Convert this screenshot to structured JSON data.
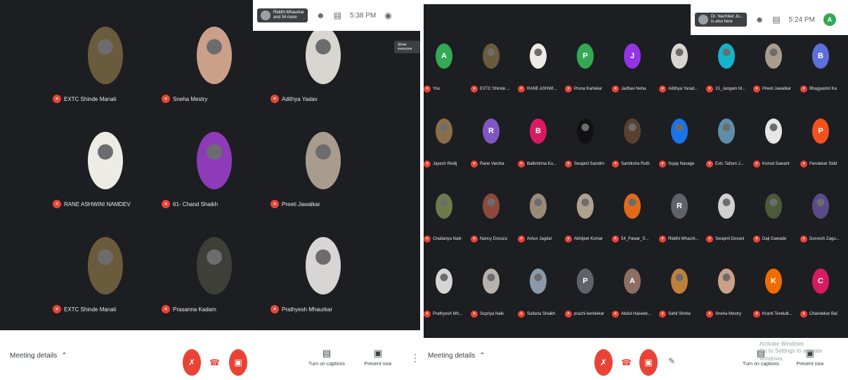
{
  "left": {
    "chip": {
      "name": "Riddhi Mhaurkar",
      "sub": "and 34 more"
    },
    "time": "5:38 PM",
    "tooltip": "Show everyone",
    "tiles": [
      {
        "name": "EXTC Shinde Manali",
        "color": "#6b5b3d"
      },
      {
        "name": "Sneha Mestry",
        "color": "#caa089"
      },
      {
        "name": "Adithya Yadav",
        "color": "#d9d6d2"
      },
      {
        "name": "RANE ASHWINI NAMDEV",
        "color": "#ecebe4"
      },
      {
        "name": "61- Chand Shaikh",
        "color": "#8d3bb8"
      },
      {
        "name": "Preeti Jawalkar",
        "color": "#a89c8e"
      },
      {
        "name": "EXTC Shinde Manali",
        "color": "#6b5b3d"
      },
      {
        "name": "Prasanna Kadam",
        "color": "#3f3f3a"
      },
      {
        "name": "Prathyesh Mhaurkar",
        "color": "#d8d6d4"
      }
    ],
    "meeting_details": "Meeting details",
    "captions": "Turn on captions",
    "present": "Present now"
  },
  "right": {
    "chip": {
      "name": "Dr. Nachiket Jo...",
      "sub": "is also here"
    },
    "time": "5:24 PM",
    "profile_initial": "A",
    "tiles": [
      {
        "name": "You",
        "initial": "A",
        "color": "#34a853"
      },
      {
        "name": "EXTC Shinde ...",
        "initial": "",
        "color": "#6b5b3d"
      },
      {
        "name": "RANE ASHWI...",
        "initial": "",
        "color": "#ecebe4"
      },
      {
        "name": "Pruna Karlekar",
        "initial": "P",
        "color": "#34a853"
      },
      {
        "name": "Jadhav Neha",
        "initial": "J",
        "color": "#9334e6"
      },
      {
        "name": "Adithya Yarad...",
        "initial": "",
        "color": "#d9d6d2"
      },
      {
        "name": "15_Jangam M...",
        "initial": "",
        "color": "#12b5cb"
      },
      {
        "name": "Preeti Jawalkar",
        "initial": "",
        "color": "#a89c8e"
      },
      {
        "name": "Bhagyashri Ka",
        "initial": "B",
        "color": "#5e6fdb"
      },
      {
        "name": "Jayesh Redij",
        "initial": "",
        "color": "#8a6e4a"
      },
      {
        "name": "Rane Varsha",
        "initial": "R",
        "color": "#7e57c2"
      },
      {
        "name": "Balkrishna Ku...",
        "initial": "B",
        "color": "#d81b60"
      },
      {
        "name": "Swapnil Sandim",
        "initial": "",
        "color": "#111111"
      },
      {
        "name": "Samiksha Ruth",
        "initial": "",
        "color": "#5a4030"
      },
      {
        "name": "Sujay Navage",
        "initial": "",
        "color": "#1a73e8"
      },
      {
        "name": "Extc Tafsen J...",
        "initial": "",
        "color": "#5f8fa8"
      },
      {
        "name": "Komal Sawant",
        "initial": "",
        "color": "#e6e6e6"
      },
      {
        "name": "Parulekar Sidd",
        "initial": "P",
        "color": "#f4511e"
      },
      {
        "name": "Chaitanya Naik",
        "initial": "",
        "color": "#6d7a4a"
      },
      {
        "name": "Nancy Dsouza",
        "initial": "",
        "color": "#8d4a3c"
      },
      {
        "name": "Ankur Jagdal",
        "initial": "",
        "color": "#9a8a78"
      },
      {
        "name": "Abhijeet Kumar",
        "initial": "",
        "color": "#b0a090"
      },
      {
        "name": "54_Pawar_S...",
        "initial": "",
        "color": "#e06a1a"
      },
      {
        "name": "Riddhi Mhaurk...",
        "initial": "R",
        "color": "#5f6368"
      },
      {
        "name": "Swapnil Dosani",
        "initial": "",
        "color": "#d0d0d0"
      },
      {
        "name": "Daji Gawade",
        "initial": "",
        "color": "#4a5a3a"
      },
      {
        "name": "Durvesh Zagu...",
        "initial": "",
        "color": "#5b4a8a"
      },
      {
        "name": "Prathyesh Mh...",
        "initial": "",
        "color": "#d8d6d4"
      },
      {
        "name": "Supriya Naik",
        "initial": "",
        "color": "#b8b2ac"
      },
      {
        "name": "Sultana Shaikh",
        "initial": "",
        "color": "#8a9aa8"
      },
      {
        "name": "prachi bendekar",
        "initial": "P",
        "color": "#5f6368"
      },
      {
        "name": "Abdul Haseeb...",
        "initial": "A",
        "color": "#8d6e63"
      },
      {
        "name": "Sahil Shirke",
        "initial": "",
        "color": "#c0803a"
      },
      {
        "name": "Sneha Mestry",
        "initial": "",
        "color": "#caa089"
      },
      {
        "name": "Kranti Tendulk...",
        "initial": "K",
        "color": "#ef6c00"
      },
      {
        "name": "Chandekar Bal",
        "initial": "C",
        "color": "#d81b60"
      }
    ],
    "meeting_details": "Meeting details",
    "captions": "Turn on captions",
    "present": "Present now",
    "watermark": {
      "line1": "Activate Windows",
      "line2": "Go to Settings to activate Windows."
    }
  }
}
